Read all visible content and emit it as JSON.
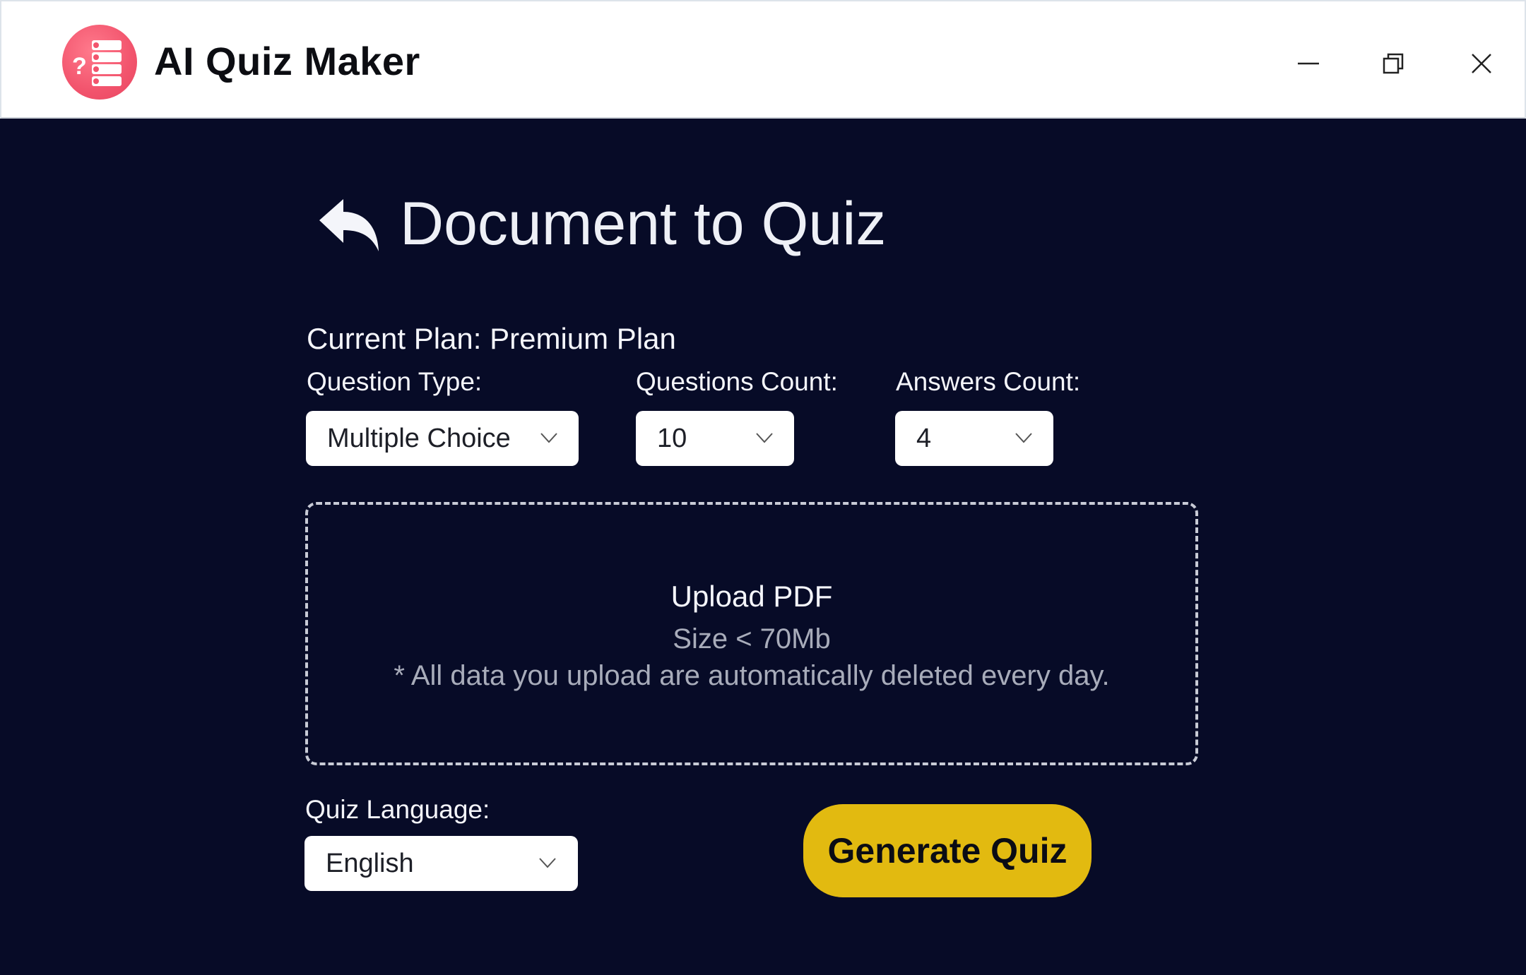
{
  "window": {
    "app_title": "AI Quiz Maker",
    "logo_icon": "quiz-logo-icon",
    "controls": [
      "minimize-icon",
      "restore-icon",
      "close-icon"
    ]
  },
  "page": {
    "title": "Document to Quiz",
    "back_icon": "back-arrow-icon"
  },
  "plan": {
    "text": "Current Plan: Premium Plan"
  },
  "options": {
    "question_type": {
      "label": "Question Type:",
      "value": "Multiple Choice"
    },
    "questions_count": {
      "label": "Questions Count:",
      "value": "10"
    },
    "answers_count": {
      "label": "Answers Count:",
      "value": "4"
    }
  },
  "upload": {
    "title": "Upload PDF",
    "size": "Size < 70Mb",
    "note": "* All data you upload are automatically deleted every day."
  },
  "language": {
    "label": "Quiz Language:",
    "value": "English"
  },
  "actions": {
    "generate_label": "Generate Quiz"
  },
  "colors": {
    "background": "#070b27",
    "accent_button": "#e2ba10",
    "logo": "#f2546d"
  }
}
